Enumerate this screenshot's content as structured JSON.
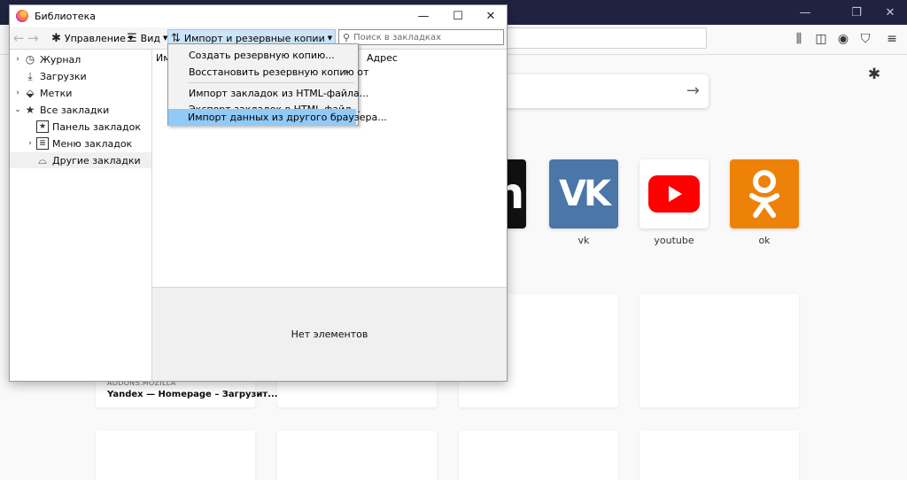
{
  "library_window": {
    "title": "Библиотека",
    "toolbar": {
      "manage_label": "Управление",
      "view_label": "Вид",
      "import_label": "Импорт и резервные копии",
      "search_placeholder": "Поиск в закладках"
    },
    "tree": [
      {
        "label": "Журнал",
        "icon": "clock-icon",
        "twisty": "›"
      },
      {
        "label": "Загрузки",
        "icon": "download-icon",
        "twisty": ""
      },
      {
        "label": "Метки",
        "icon": "tag-icon",
        "twisty": "›"
      },
      {
        "label": "Все закладки",
        "icon": "star-icon",
        "twisty": "⌄"
      },
      {
        "label": "Панель закладок",
        "icon": "star-box-icon",
        "twisty": ""
      },
      {
        "label": "Меню закладок",
        "icon": "menu-list-icon",
        "twisty": "›"
      },
      {
        "label": "Другие закладки",
        "icon": "tray-icon",
        "twisty": ""
      }
    ],
    "list": {
      "col_name": "Им",
      "col_address": "Адрес"
    },
    "details_text": "Нет элементов",
    "import_menu": {
      "items": [
        "Создать резервную копию...",
        "Восстановить резервную копию от",
        "Импорт закладок из HTML-файла...",
        "Экспорт закладок в HTML-файл...",
        "Импорт данных из другого браузера..."
      ],
      "highlighted_index": 4
    }
  },
  "browser_background": {
    "top_sites": [
      {
        "label": "vk",
        "color": "#4a76a8"
      },
      {
        "label": "youtube",
        "color": "#ffffff"
      },
      {
        "label": "ok",
        "color": "#ee8208"
      }
    ],
    "highlight_card": {
      "source": "ADDONS.MOZILLA",
      "title": "Yandex — Homepage – Загрузит..."
    }
  }
}
